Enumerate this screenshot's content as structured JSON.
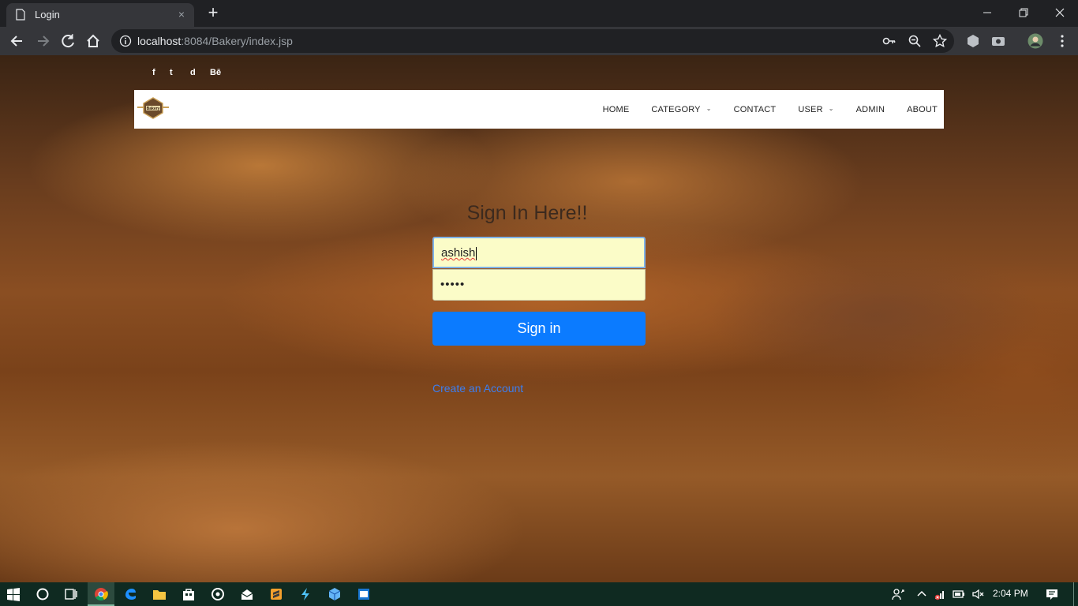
{
  "browser": {
    "tab_title": "Login",
    "tab_close": "×",
    "new_tab": "+",
    "url_host": "localhost",
    "url_rest": ":8084/Bakery/index.jsp",
    "window_controls": [
      "minimize-icon",
      "restore-icon",
      "close-icon"
    ]
  },
  "site": {
    "social": [
      "f",
      "t",
      "d",
      "Bē"
    ],
    "logo_text": "Bakery",
    "menu": [
      {
        "label": "HOME",
        "dropdown": false
      },
      {
        "label": "CATEGORY",
        "dropdown": true
      },
      {
        "label": "CONTACT",
        "dropdown": false
      },
      {
        "label": "USER",
        "dropdown": true
      },
      {
        "label": "ADMIN",
        "dropdown": false
      },
      {
        "label": "ABOUT",
        "dropdown": false
      }
    ]
  },
  "login": {
    "heading": "Sign In Here!!",
    "username_value": "ashish",
    "password_mask": "•••••",
    "button_label": "Sign in",
    "create_link": "Create an Account"
  },
  "taskbar": {
    "time": "2:04 PM"
  },
  "colors": {
    "accent": "#0b7bff",
    "link": "#3c7ef0",
    "autofill": "#fbfcc8"
  }
}
